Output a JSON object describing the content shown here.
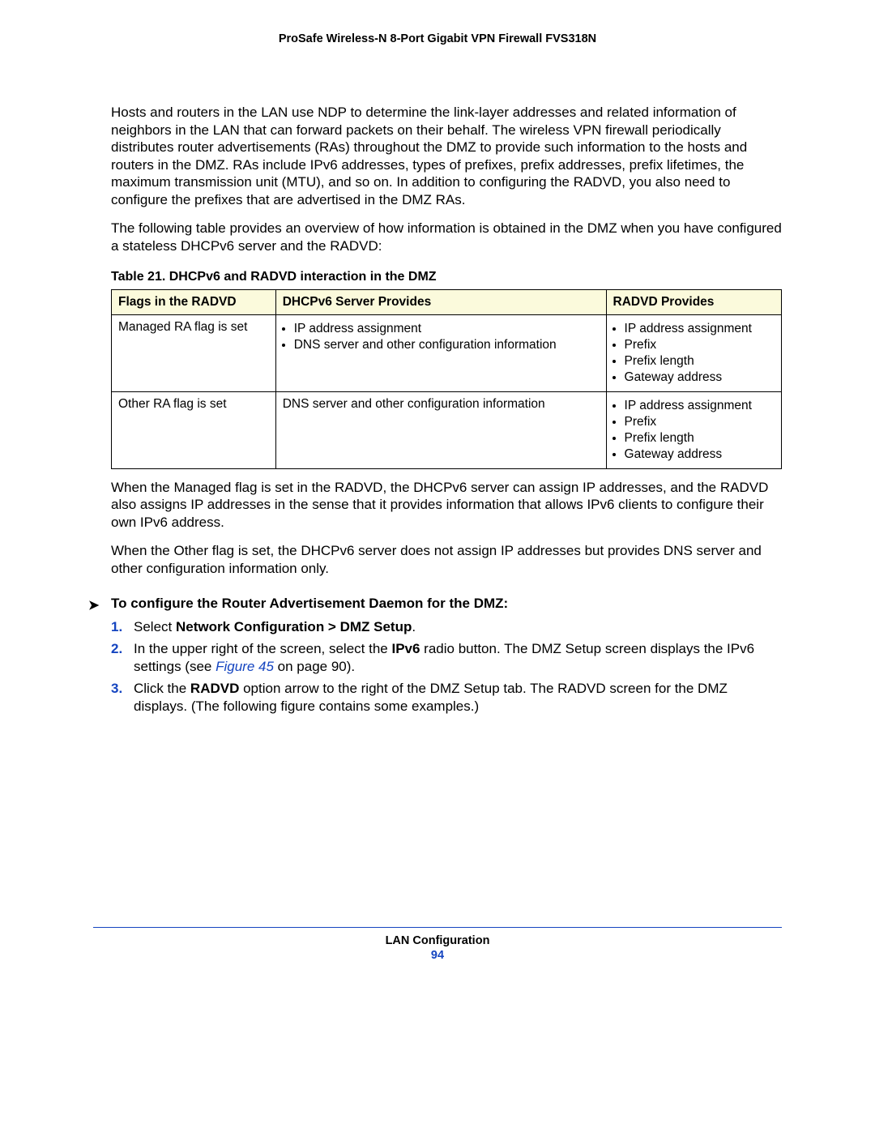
{
  "header": {
    "title": "ProSafe Wireless-N 8-Port Gigabit VPN Firewall FVS318N"
  },
  "paragraphs": {
    "p1": "Hosts and routers in the LAN use NDP to determine the link-layer addresses and related information of neighbors in the LAN that can forward packets on their behalf. The wireless VPN firewall periodically distributes router advertisements (RAs) throughout the DMZ to provide such information to the hosts and routers in the DMZ. RAs include IPv6 addresses, types of prefixes, prefix addresses, prefix lifetimes, the maximum transmission unit (MTU), and so on. In addition to configuring the RADVD, you also need to configure the prefixes that are advertised in the DMZ RAs.",
    "p2": "The following table provides an overview of how information is obtained in the DMZ when you have configured a stateless DHCPv6 server and the RADVD:",
    "p3": "When the Managed flag is set in the RADVD, the DHCPv6 server can assign IP addresses, and the RADVD also assigns IP addresses in the sense that it provides information that allows IPv6 clients to configure their own IPv6 address.",
    "p4": "When the Other flag is set, the DHCPv6 server does not assign IP addresses but provides DNS server and other configuration information only."
  },
  "table": {
    "caption": "Table 21.  DHCPv6 and RADVD interaction in the DMZ",
    "headers": {
      "c1": "Flags in the RADVD",
      "c2": "DHCPv6 Server Provides",
      "c3": "RADVD Provides"
    },
    "rows": [
      {
        "c1": "Managed RA flag is set",
        "c2_items": [
          "IP address assignment",
          "DNS server and other configuration information"
        ],
        "c3_items": [
          "IP address assignment",
          "Prefix",
          "Prefix length",
          "Gateway address"
        ]
      },
      {
        "c1": "Other RA flag is set",
        "c2_text": "DNS server and other configuration information",
        "c3_items": [
          "IP address assignment",
          "Prefix",
          "Prefix length",
          "Gateway address"
        ]
      }
    ]
  },
  "procedure": {
    "heading": "To configure the Router Advertisement Daemon for the DMZ:",
    "steps": {
      "s1_a": "Select ",
      "s1_b": "Network Configuration > DMZ Setup",
      "s1_c": ".",
      "s2_a": "In the upper right of the screen, select the ",
      "s2_b": "IPv6",
      "s2_c": " radio button. The DMZ Setup screen displays the IPv6 settings (see ",
      "s2_ref": "Figure 45",
      "s2_d": " on page 90).",
      "s3_a": "Click the ",
      "s3_b": "RADVD",
      "s3_c": " option arrow to the right of the DMZ Setup tab. The RADVD screen for the DMZ displays. (The following figure contains some examples.)"
    }
  },
  "footer": {
    "section": "LAN Configuration",
    "page": "94"
  }
}
